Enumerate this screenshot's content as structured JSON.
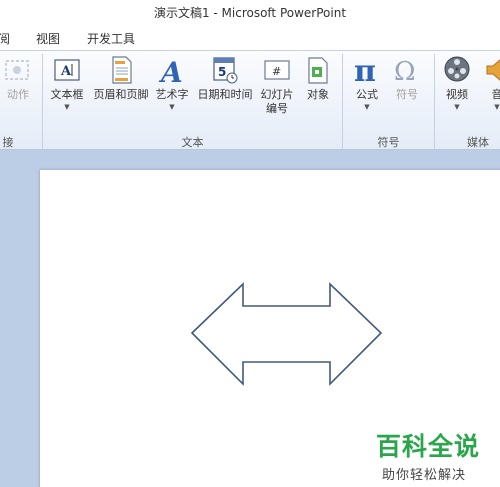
{
  "window": {
    "title": "演示文稿1  -  Microsoft PowerPoint"
  },
  "tabs": [
    "阅",
    "视图",
    "开发工具"
  ],
  "ribbon": {
    "action_label": "动作",
    "text_box_label": "文本框",
    "header_footer_label": "页眉和页脚",
    "wordart_label": "艺术字",
    "datetime_label": "日期和时间",
    "slide_number_label": "幻灯片\n编号",
    "object_label": "对象",
    "equation_label": "公式",
    "symbol_label": "符号",
    "video_label": "视频",
    "audio_label": "音",
    "groups": {
      "links": "接",
      "text": "文本",
      "symbols": "符号",
      "media": "媒体"
    }
  },
  "slide": {
    "shape": "left-right-arrow"
  },
  "watermark": {
    "main": "百科全说",
    "sub": "助你轻松解决"
  },
  "colors": {
    "arrow_stroke": "#41597f",
    "workspace": "#bccde6",
    "watermark": "#2aa64a"
  }
}
